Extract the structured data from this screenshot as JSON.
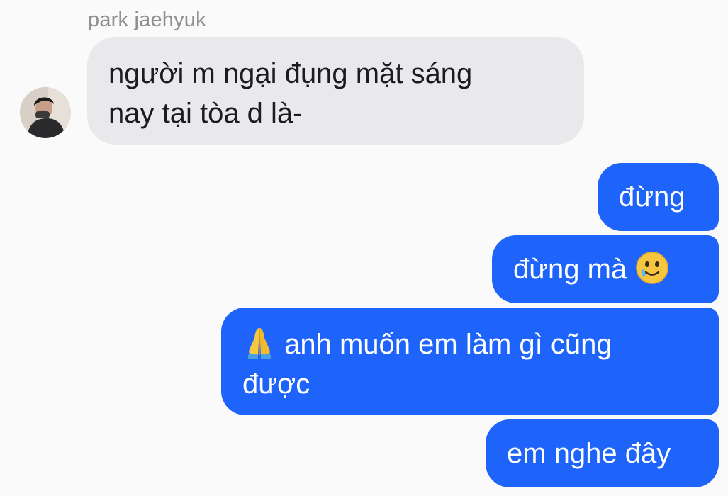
{
  "conversation": {
    "sender_name": "park jaehyuk",
    "incoming": [
      {
        "line1": "người m ngại đụng mặt sáng",
        "line2": "nay tại tòa d là-"
      }
    ],
    "outgoing": [
      {
        "text": "đừng"
      },
      {
        "text": "đừng mà",
        "emoji": "smiling-face-with-tear"
      },
      {
        "emoji": "folded-hands",
        "line1": "anh muốn em làm gì cũng",
        "line2": "được"
      },
      {
        "text": "em nghe đây"
      }
    ]
  },
  "colors": {
    "incoming_bubble": "#e9e9eb",
    "outgoing_bubble": "#1e64fa",
    "sender_name": "#8e8e93",
    "background": "#fafafa"
  }
}
